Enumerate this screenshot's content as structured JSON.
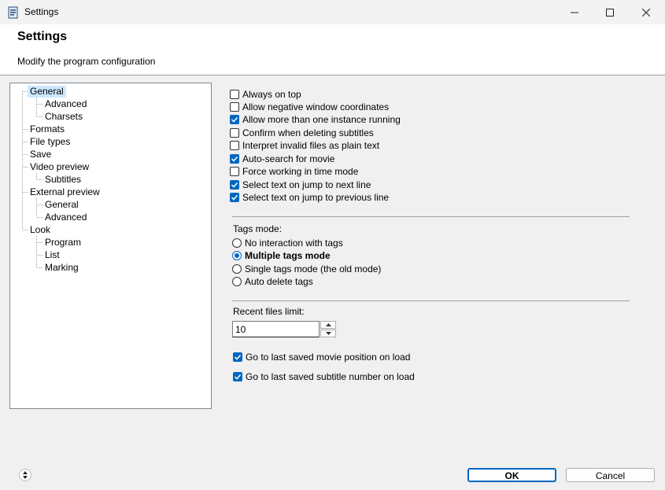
{
  "window": {
    "title": "Settings",
    "icon": "document-app-icon"
  },
  "header": {
    "title": "Settings",
    "subtitle": "Modify the program configuration"
  },
  "tree": {
    "items": [
      {
        "label": "General",
        "level": 0,
        "selected": true
      },
      {
        "label": "Advanced",
        "level": 1
      },
      {
        "label": "Charsets",
        "level": 1
      },
      {
        "label": "Formats",
        "level": 0
      },
      {
        "label": "File types",
        "level": 0
      },
      {
        "label": "Save",
        "level": 0
      },
      {
        "label": "Video preview",
        "level": 0
      },
      {
        "label": "Subtitles",
        "level": 1
      },
      {
        "label": "External preview",
        "level": 0
      },
      {
        "label": "General",
        "level": 1
      },
      {
        "label": "Advanced",
        "level": 1
      },
      {
        "label": "Look",
        "level": 0
      },
      {
        "label": "Program",
        "level": 1
      },
      {
        "label": "List",
        "level": 1
      },
      {
        "label": "Marking",
        "level": 1
      }
    ]
  },
  "general": {
    "options": [
      {
        "label": "Always on top",
        "checked": false
      },
      {
        "label": "Allow negative window coordinates",
        "checked": false
      },
      {
        "label": "Allow more than one instance running",
        "checked": true
      },
      {
        "label": "Confirm when deleting subtitles",
        "checked": false
      },
      {
        "label": "Interpret invalid files as plain text",
        "checked": false
      },
      {
        "label": "Auto-search for movie",
        "checked": true
      },
      {
        "label": "Force working in time mode",
        "checked": false
      },
      {
        "label": "Select text on jump to next line",
        "checked": true
      },
      {
        "label": "Select text on jump to previous line",
        "checked": true
      }
    ]
  },
  "tags": {
    "label": "Tags mode:",
    "options": [
      {
        "label": "No interaction with tags",
        "selected": false
      },
      {
        "label": "Multiple tags mode",
        "selected": true
      },
      {
        "label": "Single tags mode (the old mode)",
        "selected": false
      },
      {
        "label": "Auto delete tags",
        "selected": false
      }
    ]
  },
  "recent": {
    "label": "Recent files limit:",
    "value": "10",
    "options": [
      {
        "label": "Go to last saved movie position on load",
        "checked": true
      },
      {
        "label": "Go to last saved subtitle number on load",
        "checked": true
      }
    ]
  },
  "footer": {
    "ok_label": "OK",
    "cancel_label": "Cancel"
  },
  "colors": {
    "accent": "#0067c0",
    "selection": "#cce8ff"
  }
}
